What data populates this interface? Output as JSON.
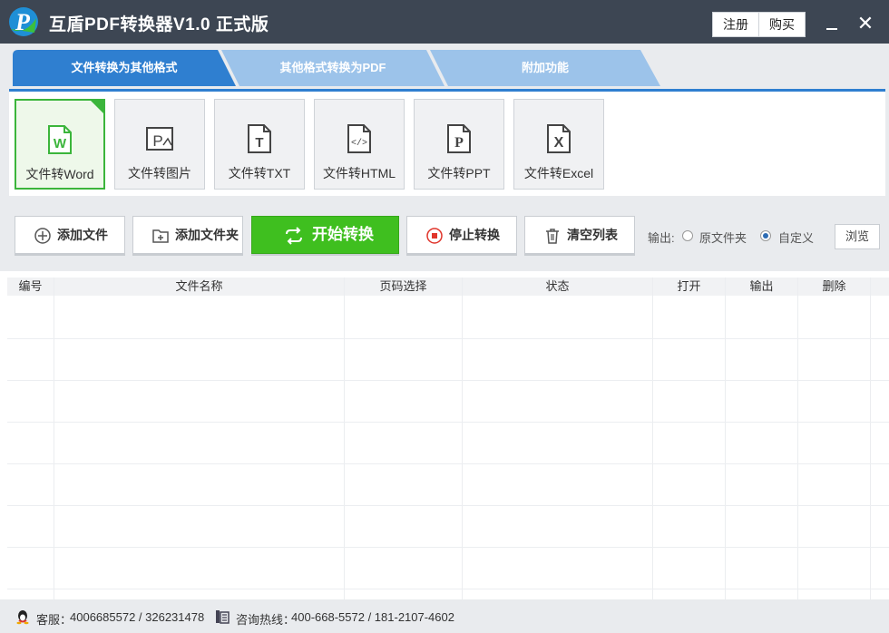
{
  "window": {
    "title": "互盾PDF转换器V1.0 正式版",
    "register_label": "注册",
    "buy_label": "购买",
    "close_glyph": "✕"
  },
  "tabs": [
    {
      "label": "文件转换为其他格式",
      "active": true
    },
    {
      "label": "其他格式转换为PDF",
      "active": false
    },
    {
      "label": "附加功能",
      "active": false
    }
  ],
  "tools": [
    {
      "label": "文件转Word",
      "icon": "word-icon",
      "glyph": "W",
      "active": true
    },
    {
      "label": "文件转图片",
      "icon": "image-icon",
      "glyph": "P",
      "active": false
    },
    {
      "label": "文件转TXT",
      "icon": "txt-icon",
      "glyph": "T",
      "active": false
    },
    {
      "label": "文件转HTML",
      "icon": "html-icon",
      "glyph": "</>",
      "active": false
    },
    {
      "label": "文件转PPT",
      "icon": "ppt-icon",
      "glyph": "P",
      "active": false
    },
    {
      "label": "文件转Excel",
      "icon": "excel-icon",
      "glyph": "X",
      "active": false
    }
  ],
  "actions": {
    "add_file": "添加文件",
    "add_folder": "添加文件夹",
    "start": "开始转换",
    "stop": "停止转换",
    "clear": "清空列表"
  },
  "output": {
    "label": "输出:",
    "option_source": "原文件夹",
    "option_custom": "自定义",
    "selected": "自定义",
    "browse": "浏览"
  },
  "table": {
    "columns": [
      "编号",
      "文件名称",
      "页码选择",
      "状态",
      "打开",
      "输出",
      "删除"
    ],
    "rows": []
  },
  "footer": {
    "service_label": "客服：",
    "service_numbers": "4006685572 / 326231478",
    "hotline_label": "咨询热线：",
    "hotline_numbers": "400-668-5572 / 181-2107-4602"
  },
  "colors": {
    "titlebar": "#3d4653",
    "accent_blue": "#2f7fd0",
    "start_green": "#3fbf1f",
    "stop_red": "#e0352b"
  }
}
